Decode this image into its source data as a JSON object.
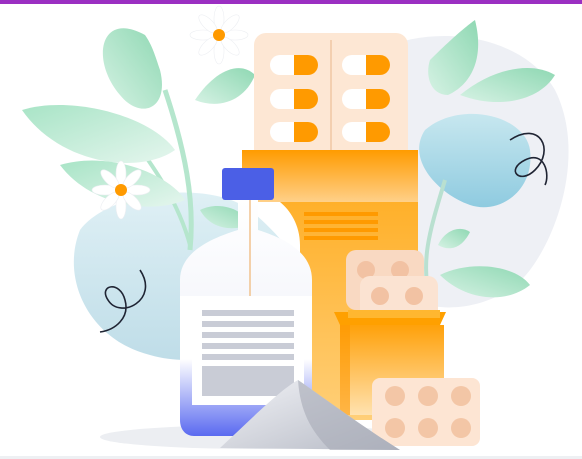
{
  "colors": {
    "accent_bar": "#9b2fc2",
    "blob_blue": "#cfe5ee",
    "blob_grey": "#eef0f5",
    "leaf_green_light": "#cdeede",
    "leaf_green": "#8ed9b4",
    "bottle_blue": "#5b6cf0",
    "cap_blue": "#4b5fe6",
    "pill_orange": "#ff9a00",
    "box_orange": "#ffae1a",
    "blister_peach": "#fde3cf",
    "powder_grey": "#c9ccd4",
    "label_grey": "#cdd0d8"
  },
  "icons": [
    "daisy-flower-icon",
    "medicine-bottle-icon",
    "blister-pack-icon",
    "pill-box-icon",
    "powder-pile-icon"
  ]
}
